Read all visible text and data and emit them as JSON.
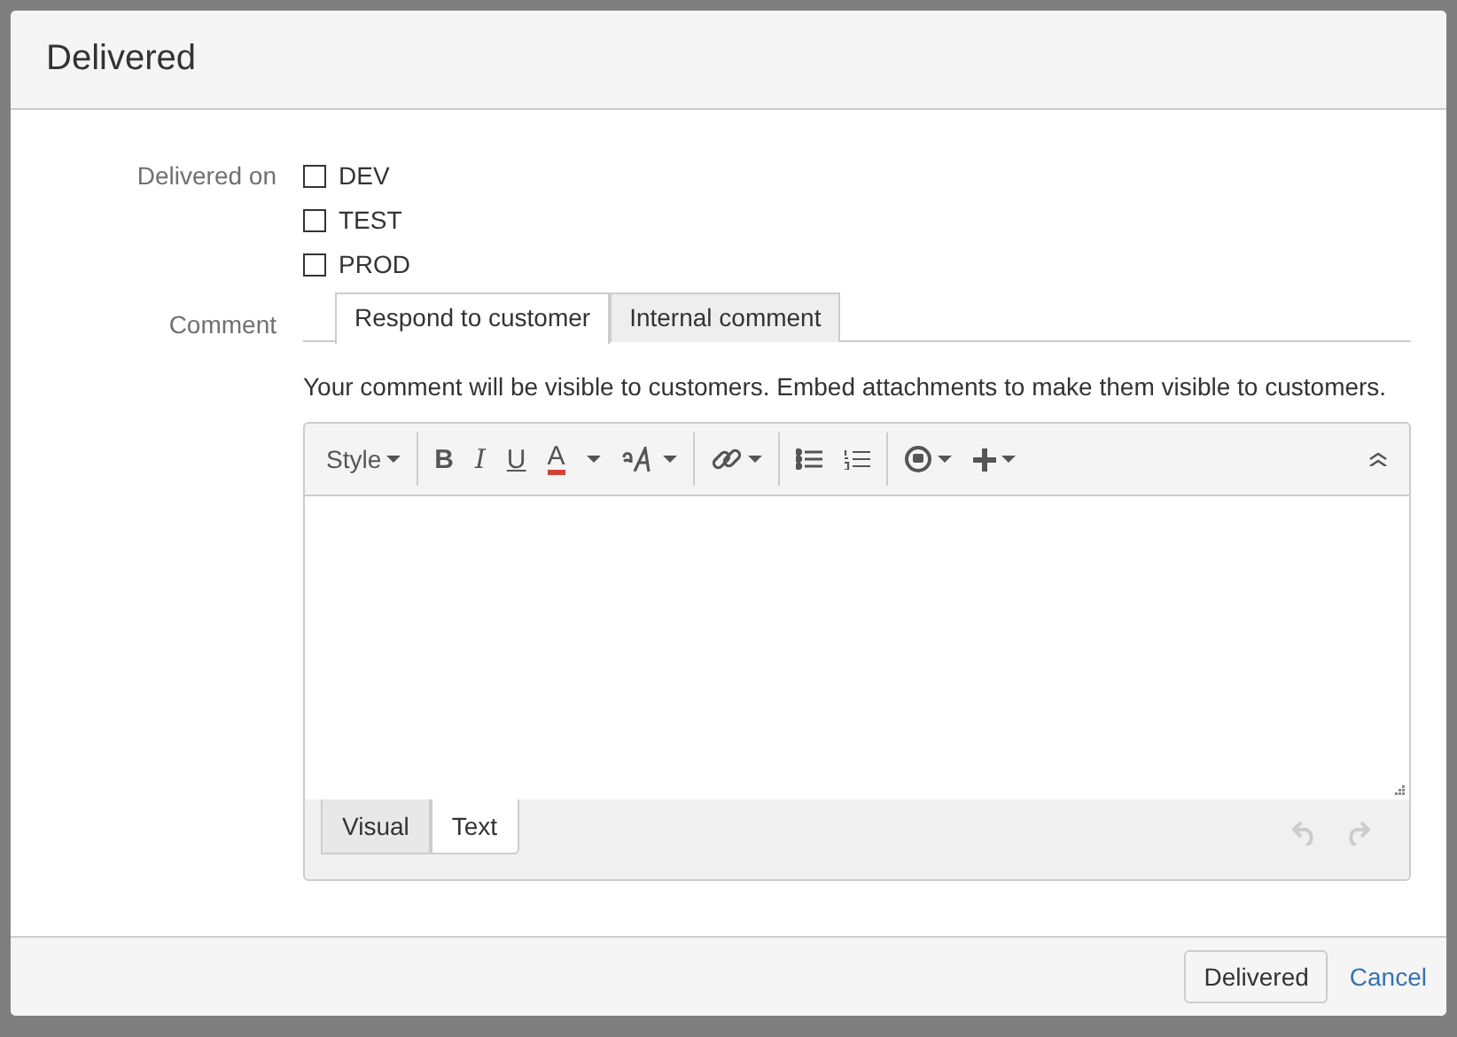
{
  "dialog": {
    "title": "Delivered",
    "fields": [
      {
        "label": "Delivered on",
        "kind": "checkboxes",
        "options": [
          {
            "label": "DEV",
            "checked": false
          },
          {
            "label": "TEST",
            "checked": false
          },
          {
            "label": "PROD",
            "checked": false
          }
        ]
      },
      {
        "label": "Comment",
        "kind": "comment",
        "tabs": [
          {
            "label": "Respond to customer",
            "selected": true
          },
          {
            "label": "Internal comment",
            "selected": false
          }
        ],
        "hint": "Your comment will be visible to customers. Embed attachments to make them visible to customers.",
        "toolbar": [
          {
            "kind": "dropdown",
            "label": "Style"
          },
          {
            "kind": "sep"
          },
          {
            "kind": "bold",
            "label": "B"
          },
          {
            "kind": "italic",
            "label": "I"
          },
          {
            "kind": "underline",
            "label": "U"
          },
          {
            "kind": "color",
            "label": "A",
            "color": "#d04437"
          },
          {
            "kind": "caret"
          },
          {
            "kind": "fontsize"
          },
          {
            "kind": "sep"
          },
          {
            "kind": "link"
          },
          {
            "kind": "sep"
          },
          {
            "kind": "bullets"
          },
          {
            "kind": "numbers"
          },
          {
            "kind": "sep"
          },
          {
            "kind": "emoji"
          },
          {
            "kind": "insert"
          },
          {
            "kind": "spacer"
          },
          {
            "kind": "collapse"
          }
        ],
        "mode_tabs": [
          {
            "label": "Visual",
            "selected": false
          },
          {
            "label": "Text",
            "selected": true
          }
        ],
        "undo_disabled": true,
        "redo_disabled": true
      }
    ],
    "buttons": [
      {
        "label": "Delivered",
        "kind": "button"
      },
      {
        "label": "Cancel",
        "kind": "link"
      }
    ]
  }
}
